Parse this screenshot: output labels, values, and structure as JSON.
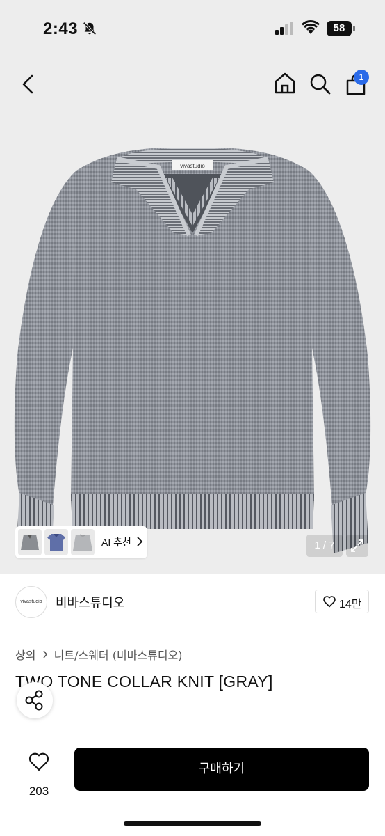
{
  "status": {
    "time": "2:43",
    "battery": "58",
    "icons": [
      "bell-slash-icon",
      "signal-icon",
      "wifi-icon",
      "battery-icon"
    ]
  },
  "nav": {
    "icons": [
      "back-icon",
      "home-icon",
      "search-icon",
      "cart-icon"
    ],
    "cart_badge": "1"
  },
  "product_image": {
    "tag_text": "vivastudio",
    "page_current": "1",
    "page_total": "7",
    "page_label": "1 / 7"
  },
  "ai_recommend": {
    "label": "AI 추천",
    "thumbnails": [
      "gray-knit-thumb",
      "blue-polo-thumb",
      "light-gray-knit-thumb"
    ]
  },
  "brand": {
    "logo_text": "vivastudio",
    "name": "비바스튜디오",
    "likes": "14만"
  },
  "breadcrumb": {
    "level1": "상의",
    "level2": "니트/스웨터 (비바스튜디오)"
  },
  "product": {
    "title": "TWO TONE COLLAR KNIT [GRAY]"
  },
  "bottom": {
    "wish_count": "203",
    "buy_label": "구매하기"
  },
  "colors": {
    "accent_blue": "#2a6ae8",
    "buy_button": "#000000",
    "hero_bg": "#ededed",
    "knit_gray": "#8e929a"
  }
}
